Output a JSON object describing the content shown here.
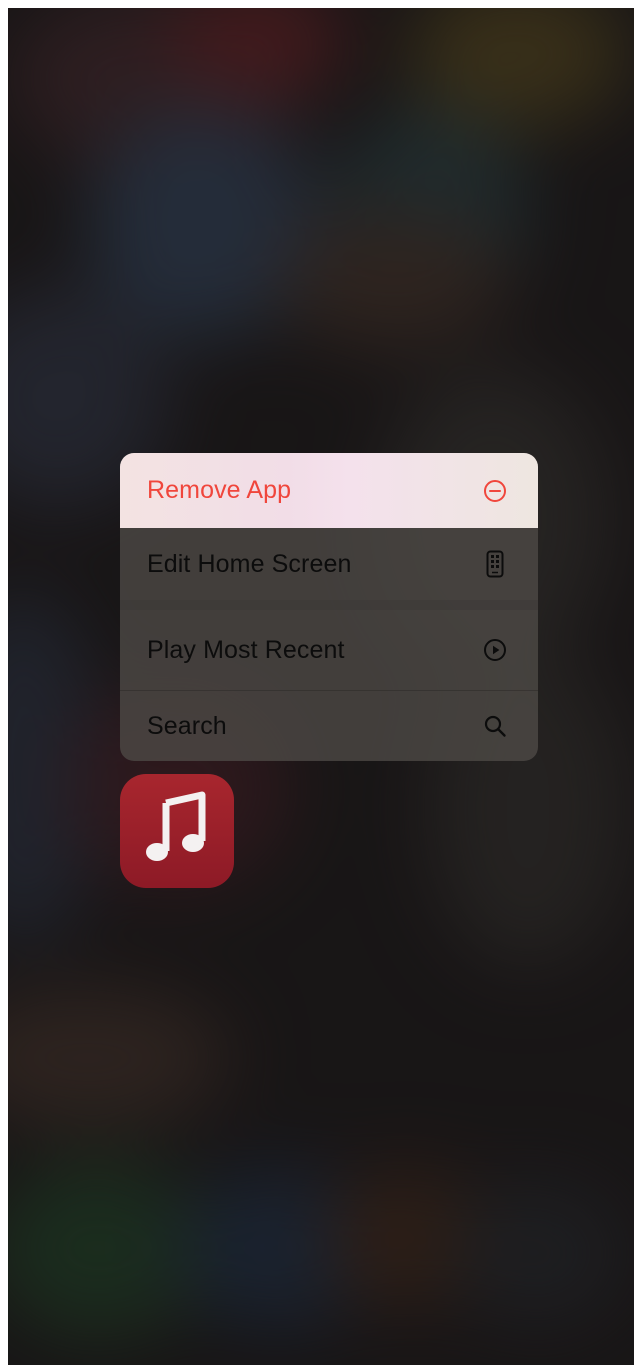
{
  "context_menu": {
    "items": [
      {
        "label": "Remove App",
        "icon": "minus-circle-icon",
        "destructive": true
      },
      {
        "label": "Edit Home Screen",
        "icon": "phone-apps-icon"
      },
      {
        "label": "Play Most Recent",
        "icon": "play-circle-icon"
      },
      {
        "label": "Search",
        "icon": "magnifying-glass-icon"
      }
    ]
  },
  "app": {
    "name": "Music",
    "icon": "music-note-icon"
  },
  "colors": {
    "destructive": "#f0463c",
    "app_icon": "#9c2029",
    "menu_text": "#0c0c0c"
  }
}
